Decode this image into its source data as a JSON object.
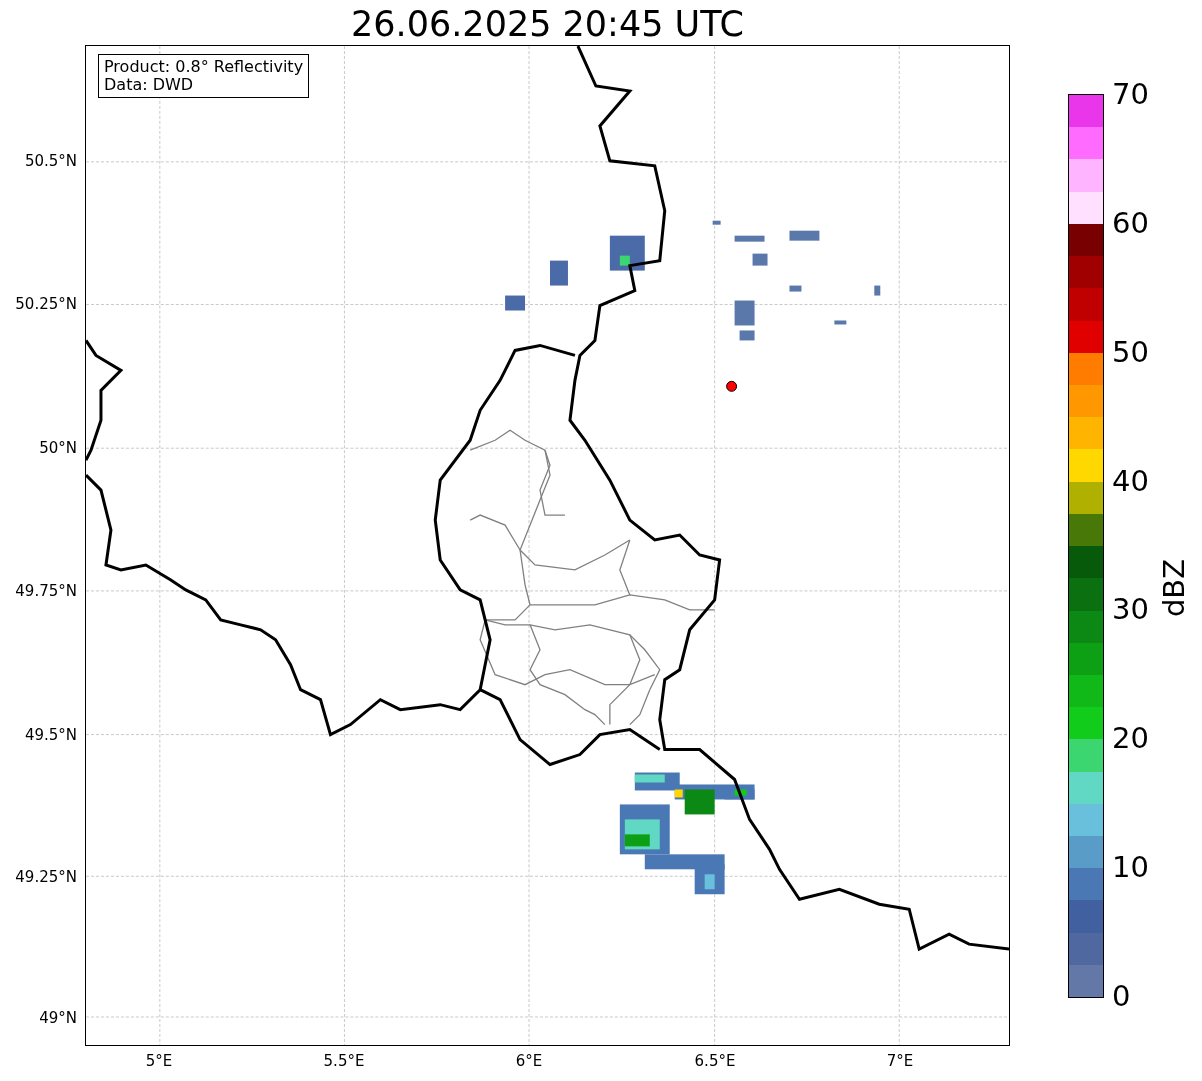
{
  "title": "26.06.2025 20:45 UTC",
  "info_box": [
    "Product: 0.8° Reflectivity",
    "Data: DWD"
  ],
  "y_ticks": [
    "50.5°N",
    "50.25°N",
    "50°N",
    "49.75°N",
    "49.5°N",
    "49.25°N",
    "49°N"
  ],
  "x_ticks": [
    "5°E",
    "5.5°E",
    "6°E",
    "6.5°E",
    "7°E"
  ],
  "colorbar": {
    "label": "dBZ",
    "ticks": [
      "70",
      "60",
      "50",
      "40",
      "30",
      "20",
      "10",
      "0"
    ],
    "bins": [
      {
        "color": "#ea36ea"
      },
      {
        "color": "#ff6aff"
      },
      {
        "color": "#ffb4ff"
      },
      {
        "color": "#ffe0ff"
      },
      {
        "color": "#780000"
      },
      {
        "color": "#a00000"
      },
      {
        "color": "#c00000"
      },
      {
        "color": "#e00000"
      },
      {
        "color": "#ff7c00"
      },
      {
        "color": "#ff9800"
      },
      {
        "color": "#ffb400"
      },
      {
        "color": "#ffd800"
      },
      {
        "color": "#b0b000"
      },
      {
        "color": "#487808"
      },
      {
        "color": "#065a0a"
      },
      {
        "color": "#0a7010"
      },
      {
        "color": "#0c8814"
      },
      {
        "color": "#0ea014"
      },
      {
        "color": "#10b818"
      },
      {
        "color": "#12cc1c"
      },
      {
        "color": "#3cd670"
      },
      {
        "color": "#60d8c4"
      },
      {
        "color": "#68c0dc"
      },
      {
        "color": "#5a9cc8"
      },
      {
        "color": "#4a78b4"
      },
      {
        "color": "#4060a0"
      },
      {
        "color": "#5068a0"
      },
      {
        "color": "#6478a8"
      }
    ]
  }
}
